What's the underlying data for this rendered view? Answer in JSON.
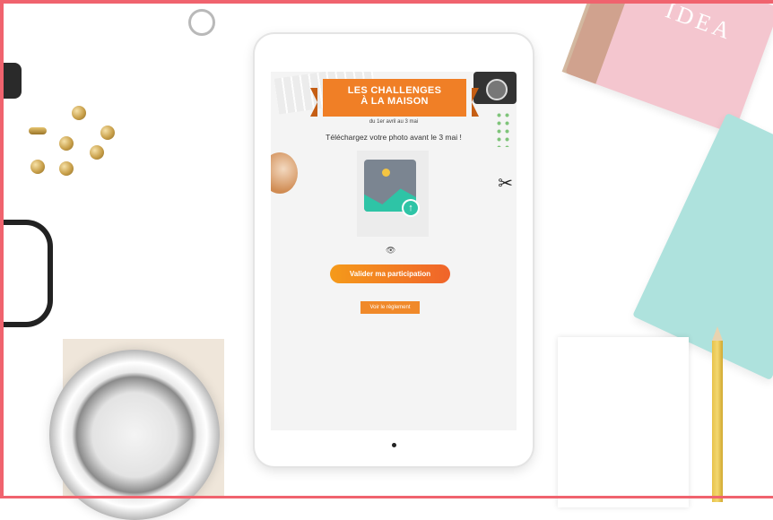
{
  "banner": {
    "line1": "LES CHALLENGES",
    "line2": "À LA MAISON"
  },
  "dates": "du 1er avril au 3 mai",
  "instruction": "Téléchargez votre photo avant le 3 mai !",
  "upload": {
    "icon": "image-upload-icon"
  },
  "preview_icon": "eye-icon",
  "submit_label": "Valider ma participation",
  "rules_label": "Voir le règlement",
  "decor": {
    "notebook_text": "IDEA"
  },
  "colors": {
    "accent": "#f07f26",
    "frame": "#f0636e",
    "mint": "#2ec4a6"
  }
}
